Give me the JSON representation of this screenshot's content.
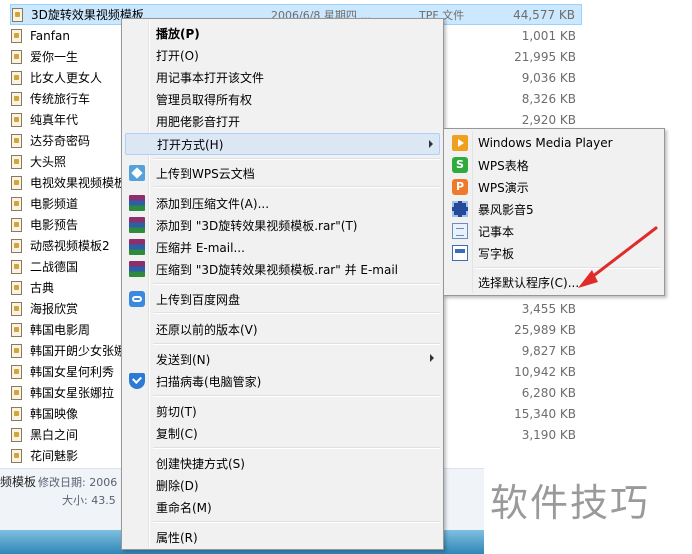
{
  "files": [
    {
      "name": "3D旋转效果视频模板",
      "date": "2006/6/8 星期四 ...",
      "type": "TPF 文件",
      "size": "44,577 KB",
      "selected": true
    },
    {
      "name": "Fanfan",
      "size": "1,001 KB"
    },
    {
      "name": "爱你一生",
      "size": "21,995 KB"
    },
    {
      "name": "比女人更女人",
      "size": "9,036 KB"
    },
    {
      "name": "传统旅行车",
      "size": "8,326 KB"
    },
    {
      "name": "纯真年代",
      "size": "2,920 KB"
    },
    {
      "name": "达芬奇密码",
      "size": ""
    },
    {
      "name": "大头照",
      "size": ""
    },
    {
      "name": "电视效果视频模板",
      "size": ""
    },
    {
      "name": "电影频道",
      "size": ""
    },
    {
      "name": "电影预告",
      "size": ""
    },
    {
      "name": "动感视频模板2",
      "size": ""
    },
    {
      "name": "二战德国",
      "size": ""
    },
    {
      "name": "古典",
      "size": ""
    },
    {
      "name": "海报欣赏",
      "size": "3,455 KB"
    },
    {
      "name": "韩国电影周",
      "size": "25,989 KB"
    },
    {
      "name": "韩国开朗少女张娜",
      "size": "9,827 KB"
    },
    {
      "name": "韩国女星何利秀",
      "size": "10,942 KB"
    },
    {
      "name": "韩国女星张娜拉",
      "size": "6,280 KB"
    },
    {
      "name": "韩国映像",
      "size": "15,340 KB"
    },
    {
      "name": "黑白之间",
      "size": "3,190 KB"
    },
    {
      "name": "花间魅影",
      "size": ""
    }
  ],
  "details": {
    "name_fragment": "频模板",
    "modified_label": "修改日期: 2006",
    "size_label": "大小: 43.5"
  },
  "context_menu": {
    "items": [
      {
        "label": "播放(P)",
        "bold": true
      },
      {
        "label": "打开(O)"
      },
      {
        "label": "用记事本打开该文件"
      },
      {
        "label": "管理员取得所有权"
      },
      {
        "label": "用肥佬影音打开"
      },
      {
        "label": "打开方式(H)",
        "submenu": true,
        "highlighted": true
      },
      {
        "label": "上传到WPS云文档",
        "icon": "wps-cloud-icon"
      },
      {
        "label": "添加到压缩文件(A)...",
        "icon": "winrar-icon"
      },
      {
        "label": "添加到 \"3D旋转效果视频模板.rar\"(T)",
        "icon": "winrar-icon"
      },
      {
        "label": "压缩并 E-mail...",
        "icon": "winrar-icon"
      },
      {
        "label": "压缩到 \"3D旋转效果视频模板.rar\" 并 E-mail",
        "icon": "winrar-icon"
      },
      {
        "label": "上传到百度网盘",
        "icon": "baidu-netdisk-icon"
      },
      {
        "label": "还原以前的版本(V)"
      },
      {
        "label": "发送到(N)",
        "submenu": true
      },
      {
        "label": "扫描病毒(电脑管家)",
        "icon": "pc-manager-shield-icon"
      },
      {
        "label": "剪切(T)"
      },
      {
        "label": "复制(C)"
      },
      {
        "label": "创建快捷方式(S)"
      },
      {
        "label": "删除(D)"
      },
      {
        "label": "重命名(M)"
      },
      {
        "label": "属性(R)"
      }
    ]
  },
  "open_with_submenu": {
    "items": [
      {
        "label": "Windows Media Player",
        "icon": "windows-media-player-icon"
      },
      {
        "label": "WPS表格",
        "icon": "wps-spreadsheet-icon"
      },
      {
        "label": "WPS演示",
        "icon": "wps-presentation-icon"
      },
      {
        "label": "暴风影音5",
        "icon": "baofeng-player-icon"
      },
      {
        "label": "记事本",
        "icon": "notepad-icon"
      },
      {
        "label": "写字板",
        "icon": "wordpad-icon"
      },
      {
        "label": "选择默认程序(C)..."
      }
    ]
  },
  "colors": {
    "selection": "#cce8ff",
    "menu_bg": "#f1f1f1",
    "annotation_arrow": "#e02b2b"
  },
  "watermark": "软件技巧"
}
